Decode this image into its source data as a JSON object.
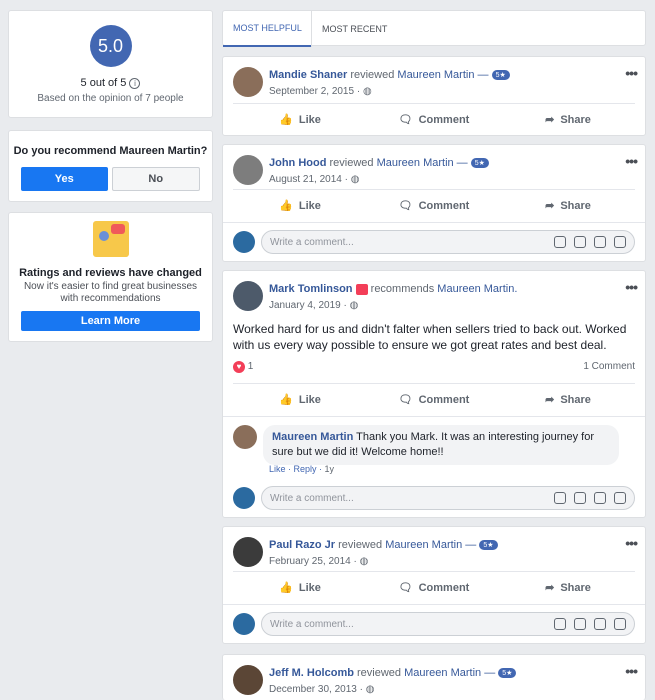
{
  "business": {
    "name": "Maureen Martin"
  },
  "rating": {
    "score": "5.0",
    "out_of": "5 out of 5",
    "basis": "Based on the opinion of 7 people"
  },
  "recommend": {
    "question": "Do you recommend Maureen Martin?",
    "yes_label": "Yes",
    "no_label": "No"
  },
  "notice": {
    "title": "Ratings and reviews have changed",
    "body": "Now it's easier to find great businesses with recommendations",
    "button": "Learn More"
  },
  "tabs": [
    {
      "label": "MOST HELPFUL",
      "active": true
    },
    {
      "label": "MOST RECENT",
      "active": false
    }
  ],
  "actions": {
    "like": "Like",
    "comment": "Comment",
    "share": "Share"
  },
  "comment_placeholder": "Write a comment...",
  "posts": [
    {
      "author": "Mandie Shaner",
      "verb": "reviewed",
      "target": "Maureen Martin —",
      "badge": "5★",
      "date": "September 2, 2015 ·"
    },
    {
      "author": "John Hood",
      "verb": "reviewed",
      "target": "Maureen Martin —",
      "badge": "5★",
      "date": "August 21, 2014 ·"
    },
    {
      "author": "Mark Tomlinson",
      "verb": "recommends",
      "target": "Maureen Martin.",
      "date": "January 4, 2019 ·",
      "text": "Worked hard for us and didn't falter when sellers tried to back out. Worked with us every way possible to ensure we got great rates and best deal.",
      "reactions": "1",
      "comment_count": "1 Comment",
      "reply": {
        "author": "Maureen Martin",
        "text": "Thank you Mark. It was an interesting journey for sure but we did it! Welcome home!!",
        "like": "Like",
        "reply": "Reply",
        "age": "1y"
      }
    },
    {
      "author": "Paul Razo Jr",
      "verb": "reviewed",
      "target": "Maureen Martin —",
      "badge": "5★",
      "date": "February 25, 2014 ·"
    },
    {
      "author": "Jeff M. Holcomb",
      "verb": "reviewed",
      "target": "Maureen Martin —",
      "badge": "5★",
      "date": "December 30, 2013 ·"
    }
  ],
  "colors": {
    "accent": "#4267b2",
    "primary_button": "#1877f2",
    "page_bg": "#e9ebee"
  }
}
